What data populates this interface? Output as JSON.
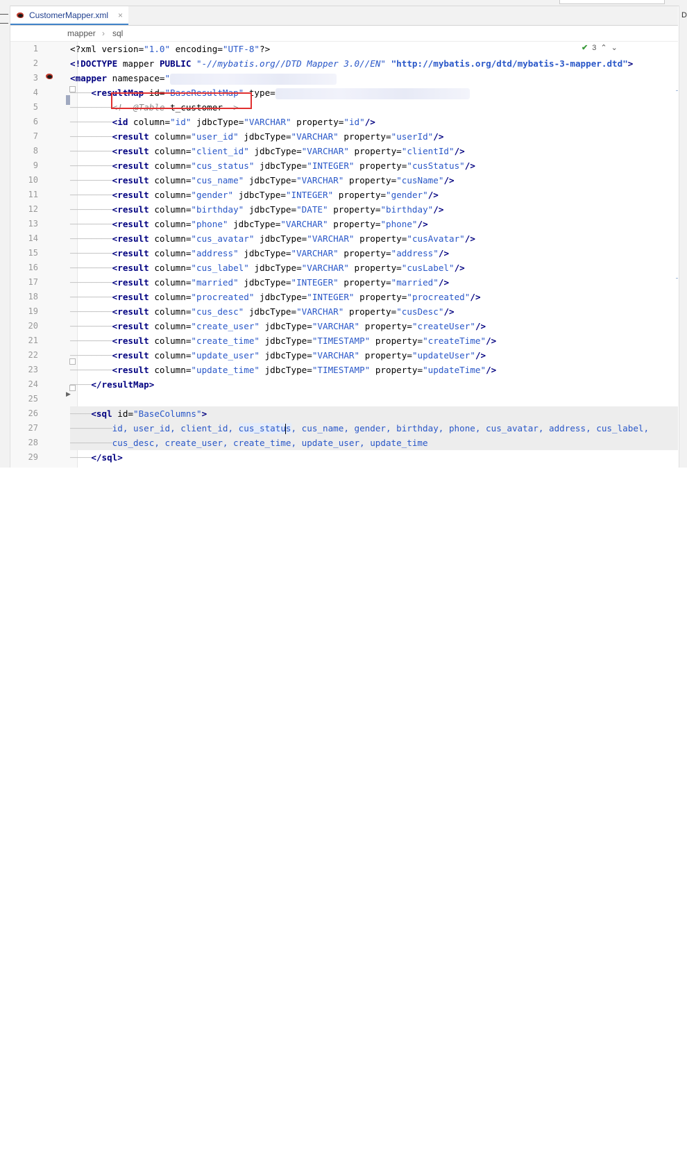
{
  "tab": {
    "filename": "CustomerMapper.xml",
    "close_glyph": "×"
  },
  "breadcrumb": {
    "items": [
      "mapper",
      "sql"
    ]
  },
  "right_strip": {
    "label": "D"
  },
  "inspection": {
    "count": "3"
  },
  "lines": [
    {
      "n": "1"
    },
    {
      "n": "2"
    },
    {
      "n": "3"
    },
    {
      "n": "4"
    },
    {
      "n": "5"
    },
    {
      "n": "6"
    },
    {
      "n": "7"
    },
    {
      "n": "8"
    },
    {
      "n": "9"
    },
    {
      "n": "10"
    },
    {
      "n": "11"
    },
    {
      "n": "12"
    },
    {
      "n": "13"
    },
    {
      "n": "14"
    },
    {
      "n": "15"
    },
    {
      "n": "16"
    },
    {
      "n": "17"
    },
    {
      "n": "18"
    },
    {
      "n": "19"
    },
    {
      "n": "20"
    },
    {
      "n": "21"
    },
    {
      "n": "22"
    },
    {
      "n": "23"
    },
    {
      "n": "24"
    },
    {
      "n": "25"
    },
    {
      "n": "26"
    },
    {
      "n": "27"
    },
    {
      "n": "28"
    },
    {
      "n": "29"
    }
  ],
  "xml": {
    "decl_version": "\"1.0\"",
    "decl_encoding": "\"UTF-8\"",
    "doctype_id": "\"-//mybatis.org//DTD Mapper 3.0//EN\"",
    "doctype_url": "\"http://mybatis.org/dtd/mybatis-3-mapper.dtd\"",
    "resultmap_id": "\"BaseResultMap\"",
    "comment_prefix": "<!--@Table",
    "comment_table": "t_customer",
    "comment_suffix": "-->",
    "sql_id": "\"BaseColumns\""
  },
  "result_rows": [
    {
      "tag": "<id",
      "column": "\"id\"",
      "jdbc": "\"VARCHAR\"",
      "prop": "\"id\""
    },
    {
      "tag": "<result",
      "column": "\"user_id\"",
      "jdbc": "\"VARCHAR\"",
      "prop": "\"userId\""
    },
    {
      "tag": "<result",
      "column": "\"client_id\"",
      "jdbc": "\"VARCHAR\"",
      "prop": "\"clientId\""
    },
    {
      "tag": "<result",
      "column": "\"cus_status\"",
      "jdbc": "\"INTEGER\"",
      "prop": "\"cusStatus\""
    },
    {
      "tag": "<result",
      "column": "\"cus_name\"",
      "jdbc": "\"VARCHAR\"",
      "prop": "\"cusName\""
    },
    {
      "tag": "<result",
      "column": "\"gender\"",
      "jdbc": "\"INTEGER\"",
      "prop": "\"gender\""
    },
    {
      "tag": "<result",
      "column": "\"birthday\"",
      "jdbc": "\"DATE\"",
      "prop": "\"birthday\""
    },
    {
      "tag": "<result",
      "column": "\"phone\"",
      "jdbc": "\"VARCHAR\"",
      "prop": "\"phone\""
    },
    {
      "tag": "<result",
      "column": "\"cus_avatar\"",
      "jdbc": "\"VARCHAR\"",
      "prop": "\"cusAvatar\""
    },
    {
      "tag": "<result",
      "column": "\"address\"",
      "jdbc": "\"VARCHAR\"",
      "prop": "\"address\""
    },
    {
      "tag": "<result",
      "column": "\"cus_label\"",
      "jdbc": "\"VARCHAR\"",
      "prop": "\"cusLabel\""
    },
    {
      "tag": "<result",
      "column": "\"married\"",
      "jdbc": "\"INTEGER\"",
      "prop": "\"married\""
    },
    {
      "tag": "<result",
      "column": "\"procreated\"",
      "jdbc": "\"INTEGER\"",
      "prop": "\"procreated\""
    },
    {
      "tag": "<result",
      "column": "\"cus_desc\"",
      "jdbc": "\"VARCHAR\"",
      "prop": "\"cusDesc\""
    },
    {
      "tag": "<result",
      "column": "\"create_user\"",
      "jdbc": "\"VARCHAR\"",
      "prop": "\"createUser\""
    },
    {
      "tag": "<result",
      "column": "\"create_time\"",
      "jdbc": "\"TIMESTAMP\"",
      "prop": "\"createTime\""
    },
    {
      "tag": "<result",
      "column": "\"update_user\"",
      "jdbc": "\"VARCHAR\"",
      "prop": "\"updateUser\""
    },
    {
      "tag": "<result",
      "column": "\"update_time\"",
      "jdbc": "\"TIMESTAMP\"",
      "prop": "\"updateTime\""
    }
  ],
  "sql_line1_before": "id, user_id, client_id, ",
  "sql_line1_hl_a": "cus_statu",
  "sql_line1_hl_b": "s",
  "sql_line1_after": ", cus_name, gender, birthday, phone, cus_avatar, address, cus_label,",
  "sql_line2": "cus_desc, create_user, create_time, update_user, update_time"
}
